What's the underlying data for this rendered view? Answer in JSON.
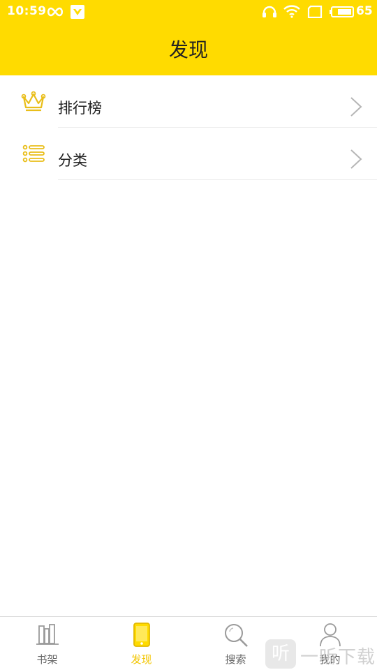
{
  "status_bar": {
    "time": "10:59",
    "battery_level": "65",
    "icons": [
      "infinity-icon",
      "vpn-shield-icon",
      "headphones-icon",
      "wifi-icon",
      "sim-icon",
      "battery-icon"
    ]
  },
  "header": {
    "title": "发现",
    "background_color": "#FFDB00"
  },
  "menu": {
    "items": [
      {
        "label": "排行榜",
        "icon": "crown-icon"
      },
      {
        "label": "分类",
        "icon": "list-icon"
      }
    ]
  },
  "tabbar": {
    "active_color": "#F2C500",
    "items": [
      {
        "label": "书架",
        "icon": "bookshelf-icon",
        "active": false
      },
      {
        "label": "发现",
        "icon": "discover-phone-icon",
        "active": true
      },
      {
        "label": "搜索",
        "icon": "search-icon",
        "active": false
      },
      {
        "label": "我的",
        "icon": "profile-icon",
        "active": false
      }
    ]
  },
  "watermark": {
    "glyph": "听",
    "text": "一听下载"
  }
}
